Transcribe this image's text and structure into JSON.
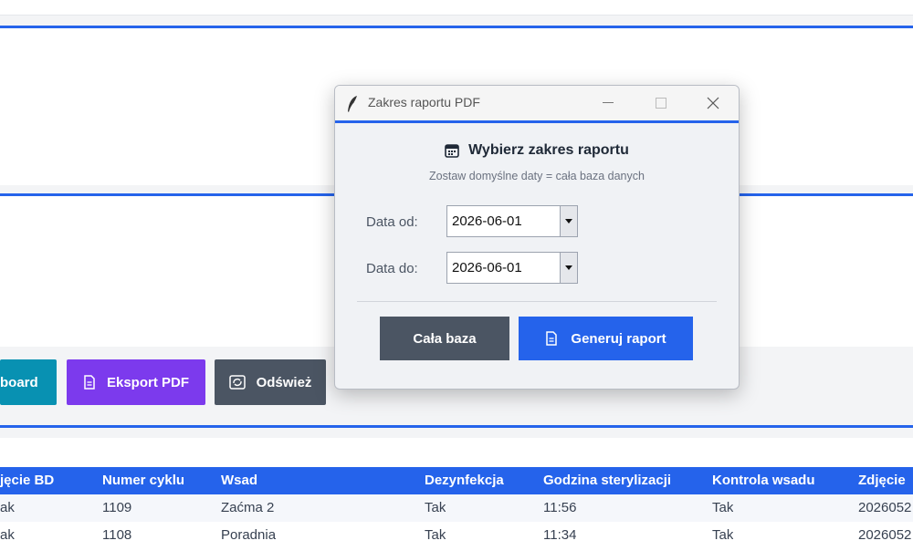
{
  "toolbar": {
    "dashboard_label": "board",
    "export_pdf_label": "Eksport PDF",
    "refresh_label": "Odśwież"
  },
  "table": {
    "columns": [
      "jęcie BD",
      "Numer cyklu",
      "Wsad",
      "Dezynfekcja",
      "Godzina sterylizacji",
      "Kontrola wsadu",
      "Zdjęcie"
    ],
    "rows": [
      [
        "ak",
        "1109",
        "Zaćma 2",
        "Tak",
        "11:56",
        "Tak",
        "2026052"
      ],
      [
        "ak",
        "1108",
        "Poradnia",
        "Tak",
        "11:34",
        "Tak",
        "2026052"
      ]
    ]
  },
  "dialog": {
    "window_title": "Zakres raportu PDF",
    "heading": "Wybierz zakres raportu",
    "subtitle": "Zostaw domyślne daty = cała baza danych",
    "from_label": "Data od:",
    "from_value": "2026-06-01",
    "to_label": "Data do:",
    "to_value": "2026-06-01",
    "whole_db_label": "Cała baza",
    "generate_label": "Generuj raport"
  },
  "colors": {
    "accent": "#2563eb",
    "dashboard": "#0891b2",
    "export_pdf": "#7c3aed",
    "refresh": "#4b5563"
  },
  "icons": [
    "feather-icon",
    "calendar-icon",
    "document-icon",
    "refresh-icon",
    "minimize-icon",
    "maximize-icon",
    "close-icon",
    "chevron-down-icon"
  ]
}
